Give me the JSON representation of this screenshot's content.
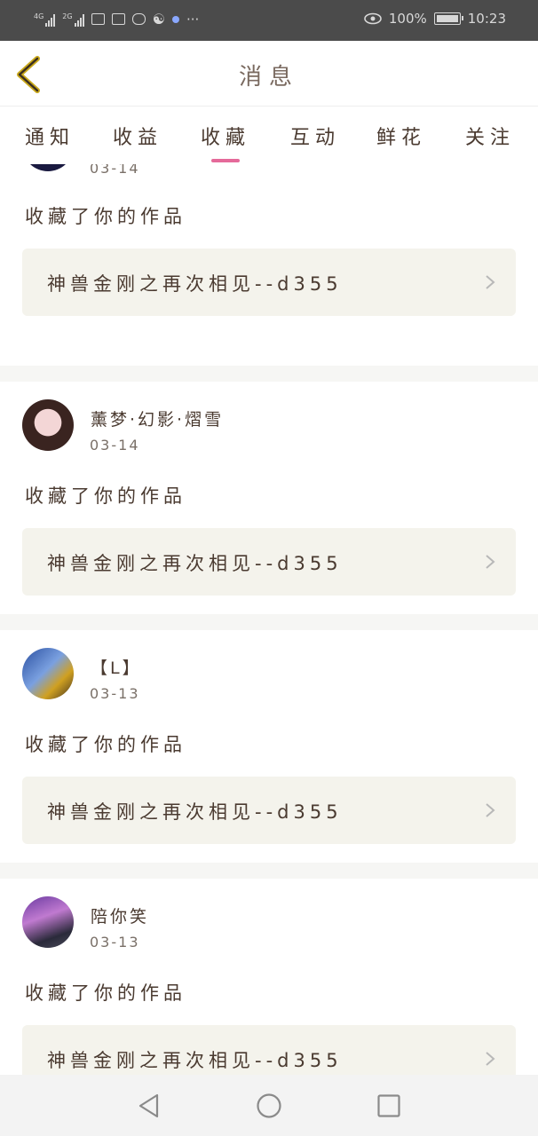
{
  "status_bar": {
    "net1": "4G",
    "net2": "2G",
    "battery": "100%",
    "time": "10:23",
    "more": "···"
  },
  "header": {
    "title": "消息"
  },
  "tabs": [
    {
      "label": "通知",
      "active": false
    },
    {
      "label": "收益",
      "active": false
    },
    {
      "label": "收藏",
      "active": true
    },
    {
      "label": "互动",
      "active": false
    },
    {
      "label": "鲜花",
      "active": false
    },
    {
      "label": "关注",
      "active": false
    }
  ],
  "accent_color": "#e56a9a",
  "items": [
    {
      "user": "",
      "date": "03-14",
      "action": "收藏了你的作品",
      "work_title": "神兽金刚之再次相见--d355"
    },
    {
      "user": "薰梦·幻影·熠雪",
      "date": "03-14",
      "action": "收藏了你的作品",
      "work_title": "神兽金刚之再次相见--d355"
    },
    {
      "user": "【L】",
      "date": "03-13",
      "action": "收藏了你的作品",
      "work_title": "神兽金刚之再次相见--d355"
    },
    {
      "user": "陪你笑",
      "date": "03-13",
      "action": "收藏了你的作品",
      "work_title": "神兽金刚之再次相见--d355"
    }
  ],
  "icons": {
    "back": "chevron-left-icon",
    "work_arrow": "chevron-right-icon",
    "nav_back": "triangle-back-icon",
    "nav_home": "circle-home-icon",
    "nav_recent": "square-recent-icon"
  }
}
